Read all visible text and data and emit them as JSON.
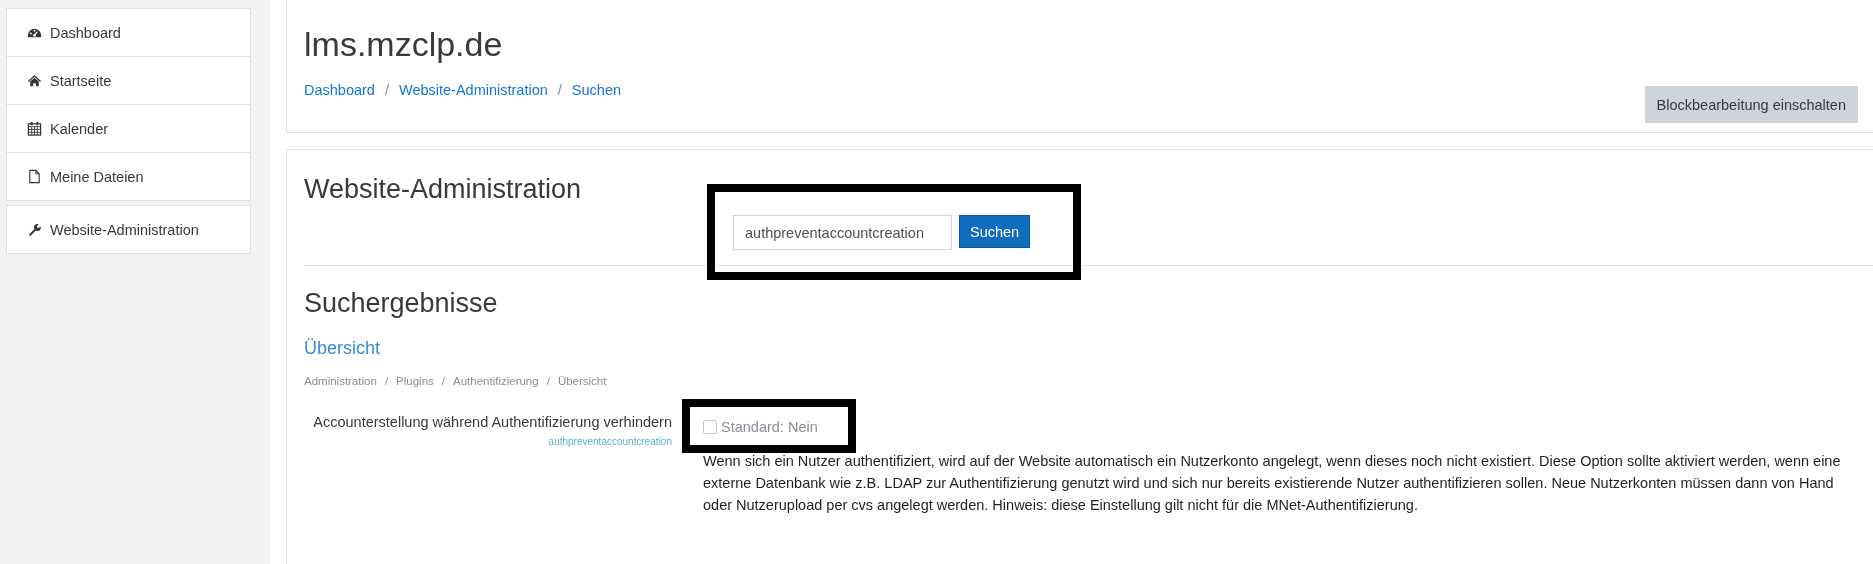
{
  "sidebar": {
    "groups": [
      {
        "items": [
          {
            "label": "Dashboard"
          },
          {
            "label": "Startseite"
          },
          {
            "label": "Kalender"
          },
          {
            "label": "Meine Dateien"
          }
        ]
      },
      {
        "items": [
          {
            "label": "Website-Administration"
          }
        ]
      }
    ]
  },
  "header": {
    "title": "lms.mzclp.de",
    "breadcrumb": [
      {
        "label": "Dashboard"
      },
      {
        "separator": "/",
        "label": "Website-Administration"
      },
      {
        "separator": "/",
        "label": "Suchen"
      }
    ],
    "button": "Blockbearbeitung einschalten"
  },
  "content": {
    "heading": "Website-Administration",
    "search": {
      "value": "authpreventaccountcreation",
      "button": "Suchen",
      "highlighted": true
    },
    "results_heading": "Suchergebnisse",
    "section_link": "Übersicht",
    "path": [
      {
        "label": "Administration"
      },
      {
        "separator": "/",
        "label": "Plugins"
      },
      {
        "separator": "/",
        "label": "Authentifizierung"
      },
      {
        "separator": "/",
        "label": "Übersicht"
      }
    ],
    "setting": {
      "label": "Accounterstellung während Authentifizierung verhindern",
      "name": "authpreventaccountcreation",
      "checked": false,
      "default": "Standard: Nein",
      "highlighted": true,
      "description": "Wenn sich ein Nutzer authentifiziert, wird auf der Website automatisch ein Nutzerkonto angelegt, wenn dieses noch nicht existiert. Diese Option sollte aktiviert werden, wenn eine externe Datenbank wie z.B. LDAP zur Authentifizierung genutzt wird und sich nur bereits existierende Nutzer authentifizieren sollen. Neue Nutzerkonten müssen dann von Hand oder Nutzerupload per cvs angelegt werden. Hinweis: diese Einstellung gilt nicht für die MNet-Authentifizierung."
    }
  }
}
